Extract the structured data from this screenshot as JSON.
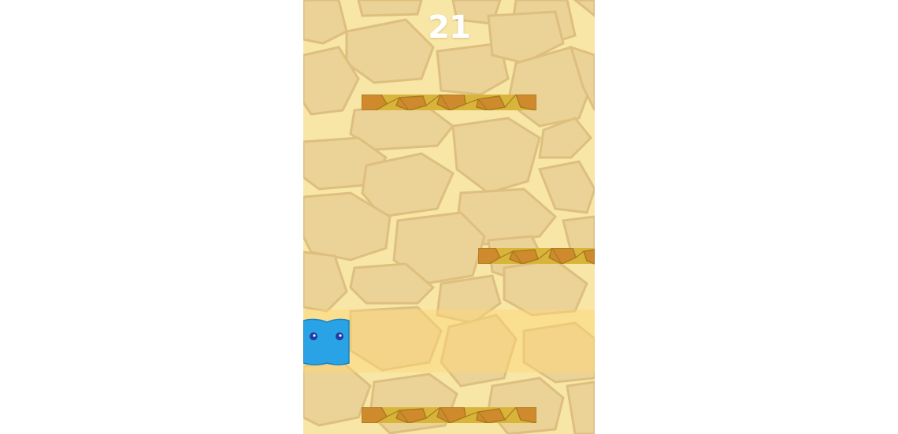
{
  "hud": {
    "score": "21"
  },
  "colors": {
    "background": "#f7e6a6",
    "stone": "#e9cf94",
    "stone_outline": "#d9b979",
    "platform_yellow": "#d9b43a",
    "platform_orange": "#d08a2e",
    "platform_line": "#a87c1c",
    "player_body": "#29a3e6",
    "player_eye": "#233a9e"
  },
  "scene": {
    "platforms": [
      {
        "name": "platform-top"
      },
      {
        "name": "platform-mid"
      },
      {
        "name": "platform-bottom"
      }
    ],
    "player": {
      "name": "blue-block-player"
    }
  }
}
